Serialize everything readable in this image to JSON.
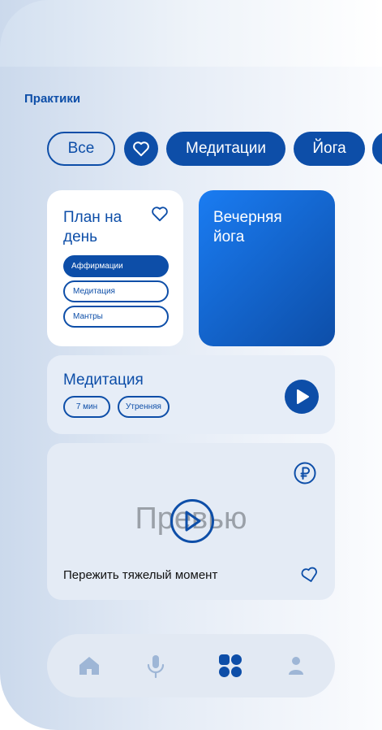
{
  "screen": {
    "title": "Практики"
  },
  "filters": {
    "items": [
      {
        "label": "Все",
        "style": "outline"
      },
      {
        "label": "",
        "icon": "heart-icon",
        "style": "solid"
      },
      {
        "label": "Медитации",
        "style": "solid"
      },
      {
        "label": "Йога",
        "style": "solid"
      }
    ]
  },
  "plan_card": {
    "title": "План на день",
    "pills": [
      {
        "label": "Аффирмации",
        "active": true
      },
      {
        "label": "Медитация",
        "active": false
      },
      {
        "label": "Мантры",
        "active": false
      }
    ]
  },
  "yoga_card": {
    "title": "Вечерняя йога"
  },
  "meditation_card": {
    "title": "Медитация",
    "tags": [
      "7 мин",
      "Утренняя"
    ]
  },
  "preview_card": {
    "placeholder": "Превью",
    "caption": "Пережить тяжелый момент",
    "price_icon": "ruble-icon"
  },
  "bottom_nav": {
    "items": [
      {
        "icon": "home-icon",
        "active": false
      },
      {
        "icon": "microphone-icon",
        "active": false
      },
      {
        "icon": "grid-icon",
        "active": true
      },
      {
        "icon": "profile-icon",
        "active": false
      }
    ]
  },
  "colors": {
    "primary": "#0d4ea8",
    "accent_gradient_start": "#1a7cf2",
    "inactive_nav": "#9eb6d6"
  }
}
